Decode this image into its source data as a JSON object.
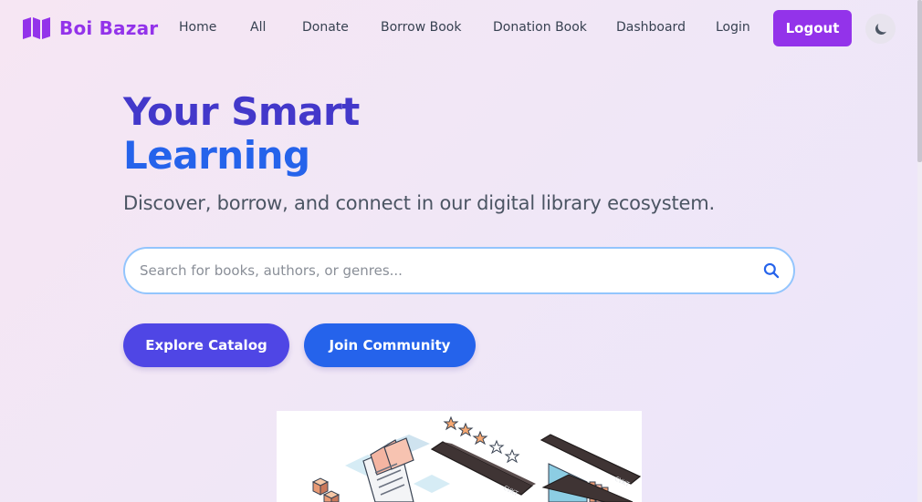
{
  "brand": {
    "name": "Boi Bazar",
    "color": "#9333ea"
  },
  "nav": {
    "items": [
      {
        "label": "Home"
      },
      {
        "label": "All"
      },
      {
        "label": "Donate"
      },
      {
        "label": "Borrow Book"
      },
      {
        "label": "Donation Book"
      },
      {
        "label": "Dashboard"
      },
      {
        "label": "Login"
      }
    ],
    "logout_label": "Logout",
    "theme_icon": "moon-icon"
  },
  "hero": {
    "title_line1": "Your Smart",
    "title_line2": "Learning",
    "subtitle": "Discover, borrow, and connect in our digital library ecosystem.",
    "search": {
      "placeholder": "Search for books, authors, or genres...",
      "value": ""
    },
    "explore_label": "Explore Catalog",
    "community_label": "Join Community"
  },
  "colors": {
    "brand": "#9333ea",
    "title_primary": "#4338ca",
    "title_secondary": "#2563eb",
    "explore_button": "#4f46e5",
    "community_button": "#2563eb"
  },
  "illustration": {
    "label": "library-books-illustration"
  }
}
